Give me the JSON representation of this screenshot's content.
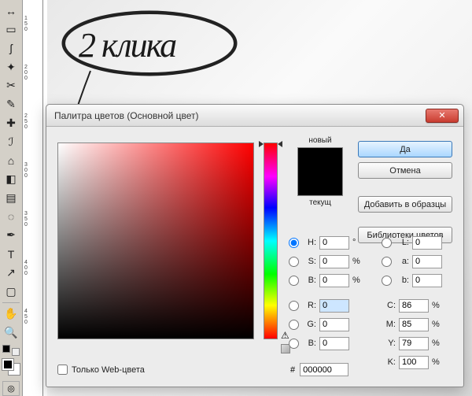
{
  "annotation": "2 клика",
  "toolbox": {
    "tools": [
      "move",
      "marquee",
      "lasso",
      "wand",
      "crop",
      "eyedropper",
      "heal",
      "brush",
      "stamp",
      "history",
      "eraser",
      "gradient",
      "blur",
      "dodge",
      "pen",
      "type",
      "path",
      "rect",
      "hand",
      "zoom"
    ]
  },
  "ruler_ticks": [
    150,
    200,
    250,
    300,
    350,
    400,
    450
  ],
  "dialog": {
    "title": "Палитра цветов (Основной цвет)",
    "new_label": "новый",
    "current_label": "текущ",
    "buttons": {
      "ok": "Да",
      "cancel": "Отмена",
      "add": "Добавить в образцы",
      "libraries": "Библиотеки цветов"
    },
    "hsb": {
      "h_label": "H:",
      "s_label": "S:",
      "b_label": "B:",
      "h": "0",
      "s": "0",
      "b": "0",
      "h_unit": "°",
      "pct": "%"
    },
    "rgb": {
      "r_label": "R:",
      "g_label": "G:",
      "b_label": "B:",
      "r": "0",
      "g": "0",
      "b": "0"
    },
    "lab": {
      "l_label": "L:",
      "a_label": "a:",
      "b_label": "b:",
      "l": "0",
      "a": "0",
      "b": "0"
    },
    "cmyk": {
      "c_label": "C:",
      "m_label": "M:",
      "y_label": "Y:",
      "k_label": "K:",
      "c": "86",
      "m": "85",
      "y": "79",
      "k": "100",
      "pct": "%"
    },
    "hex_label": "#",
    "hex": "000000",
    "web_only": "Только Web-цвета"
  }
}
